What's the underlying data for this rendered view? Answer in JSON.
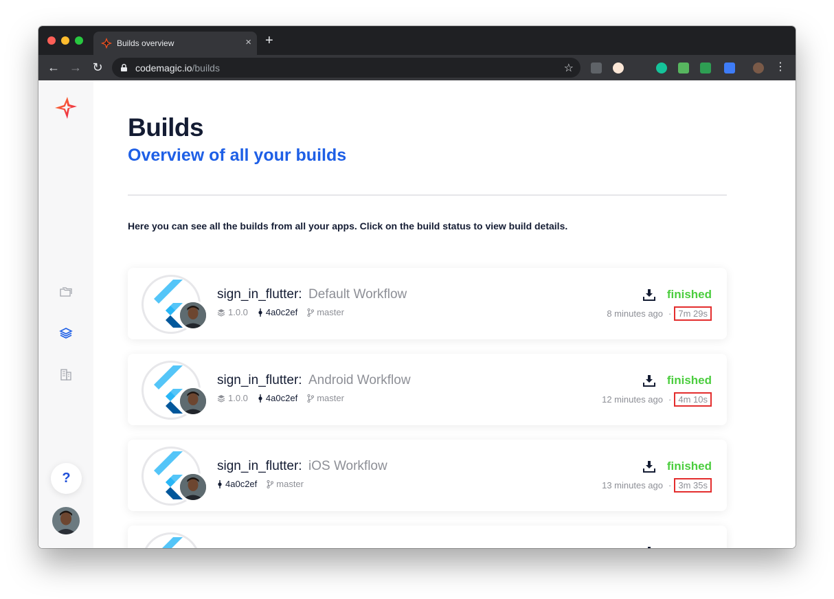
{
  "browser": {
    "tab_title": "Builds overview",
    "tab_close": "×",
    "new_tab": "+",
    "url_host": "codemagic.io",
    "url_path": "/builds",
    "back": "←",
    "forward": "→",
    "reload": "↻",
    "star": "☆",
    "menu": "⋮"
  },
  "sidebar": {
    "help_label": "?"
  },
  "page": {
    "title": "Builds",
    "subtitle": "Overview of all your builds",
    "intro": "Here you can see all the builds from all your apps. Click on the build status to view build details."
  },
  "builds": [
    {
      "app": "sign_in_flutter:",
      "workflow": "Default Workflow",
      "version": "1.0.0",
      "commit": "4a0c2ef",
      "branch": "master",
      "status": "finished",
      "time": "8 minutes ago",
      "sep": "·",
      "duration": "7m 29s"
    },
    {
      "app": "sign_in_flutter:",
      "workflow": "Android Workflow",
      "version": "1.0.0",
      "commit": "4a0c2ef",
      "branch": "master",
      "status": "finished",
      "time": "12 minutes ago",
      "sep": "·",
      "duration": "4m 10s"
    },
    {
      "app": "sign_in_flutter:",
      "workflow": "iOS Workflow",
      "commit": "4a0c2ef",
      "branch": "master",
      "status": "finished",
      "time": "13 minutes ago",
      "sep": "·",
      "duration": "3m 35s"
    }
  ],
  "colors": {
    "accent": "#1e5fe6",
    "success": "#4bcd3e",
    "highlight_box": "#e32d2d"
  }
}
